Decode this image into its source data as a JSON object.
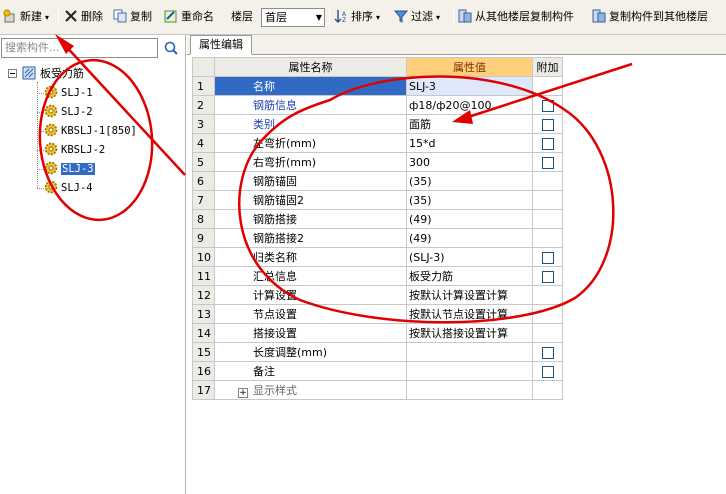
{
  "toolbar": {
    "new_label": "新建",
    "delete_label": "删除",
    "copy_label": "复制",
    "rename_label": "重命名",
    "floor_label": "楼层",
    "floor_value": "首层",
    "sort_label": "排序",
    "filter_label": "过滤",
    "copy_from_floor_label": "从其他楼层复制构件",
    "copy_to_floor_label": "复制构件到其他楼层"
  },
  "left_panel": {
    "search_placeholder": "搜索构件...",
    "tree": {
      "root_label": "板受力筋",
      "items": [
        {
          "label": "SLJ-1",
          "selected": false
        },
        {
          "label": "SLJ-2",
          "selected": false
        },
        {
          "label": "KBSLJ-1[850]",
          "selected": false
        },
        {
          "label": "KBSLJ-2",
          "selected": false
        },
        {
          "label": "SLJ-3",
          "selected": true
        },
        {
          "label": "SLJ-4",
          "selected": false
        }
      ]
    }
  },
  "right_panel": {
    "tab_label": "属性编辑",
    "grid": {
      "headers": {
        "name": "属性名称",
        "value": "属性值",
        "extra": "附加"
      },
      "rows": [
        {
          "num": "1",
          "name": "名称",
          "value": "SLJ-3",
          "checkbox": false
        },
        {
          "num": "2",
          "name": "钢筋信息",
          "value": "ф18/ф20@100",
          "checkbox": true
        },
        {
          "num": "3",
          "name": "类别",
          "value": "面筋",
          "checkbox": true
        },
        {
          "num": "4",
          "name": "左弯折(mm)",
          "value": "15*d",
          "checkbox": true
        },
        {
          "num": "5",
          "name": "右弯折(mm)",
          "value": "300",
          "checkbox": true
        },
        {
          "num": "6",
          "name": "钢筋锚固",
          "value": "(35)",
          "checkbox": false
        },
        {
          "num": "7",
          "name": "钢筋锚固2",
          "value": "(35)",
          "checkbox": false
        },
        {
          "num": "8",
          "name": "钢筋搭接",
          "value": "(49)",
          "checkbox": false
        },
        {
          "num": "9",
          "name": "钢筋搭接2",
          "value": "(49)",
          "checkbox": false
        },
        {
          "num": "10",
          "name": "归类名称",
          "value": "(SLJ-3)",
          "checkbox": true
        },
        {
          "num": "11",
          "name": "汇总信息",
          "value": "板受力筋",
          "checkbox": true
        },
        {
          "num": "12",
          "name": "计算设置",
          "value": "按默认计算设置计算",
          "checkbox": false
        },
        {
          "num": "13",
          "name": "节点设置",
          "value": "按默认节点设置计算",
          "checkbox": false
        },
        {
          "num": "14",
          "name": "搭接设置",
          "value": "按默认搭接设置计算",
          "checkbox": false
        },
        {
          "num": "15",
          "name": "长度调整(mm)",
          "value": "",
          "checkbox": true
        },
        {
          "num": "16",
          "name": "备注",
          "value": "",
          "checkbox": true
        },
        {
          "num": "17",
          "name": "显示样式",
          "value": "",
          "checkbox": false,
          "expander": "+"
        }
      ]
    }
  },
  "colors": {
    "annotation_red": "#e00000",
    "selection_blue": "#316ac5",
    "value_header_orange": "#ffcf7c"
  }
}
